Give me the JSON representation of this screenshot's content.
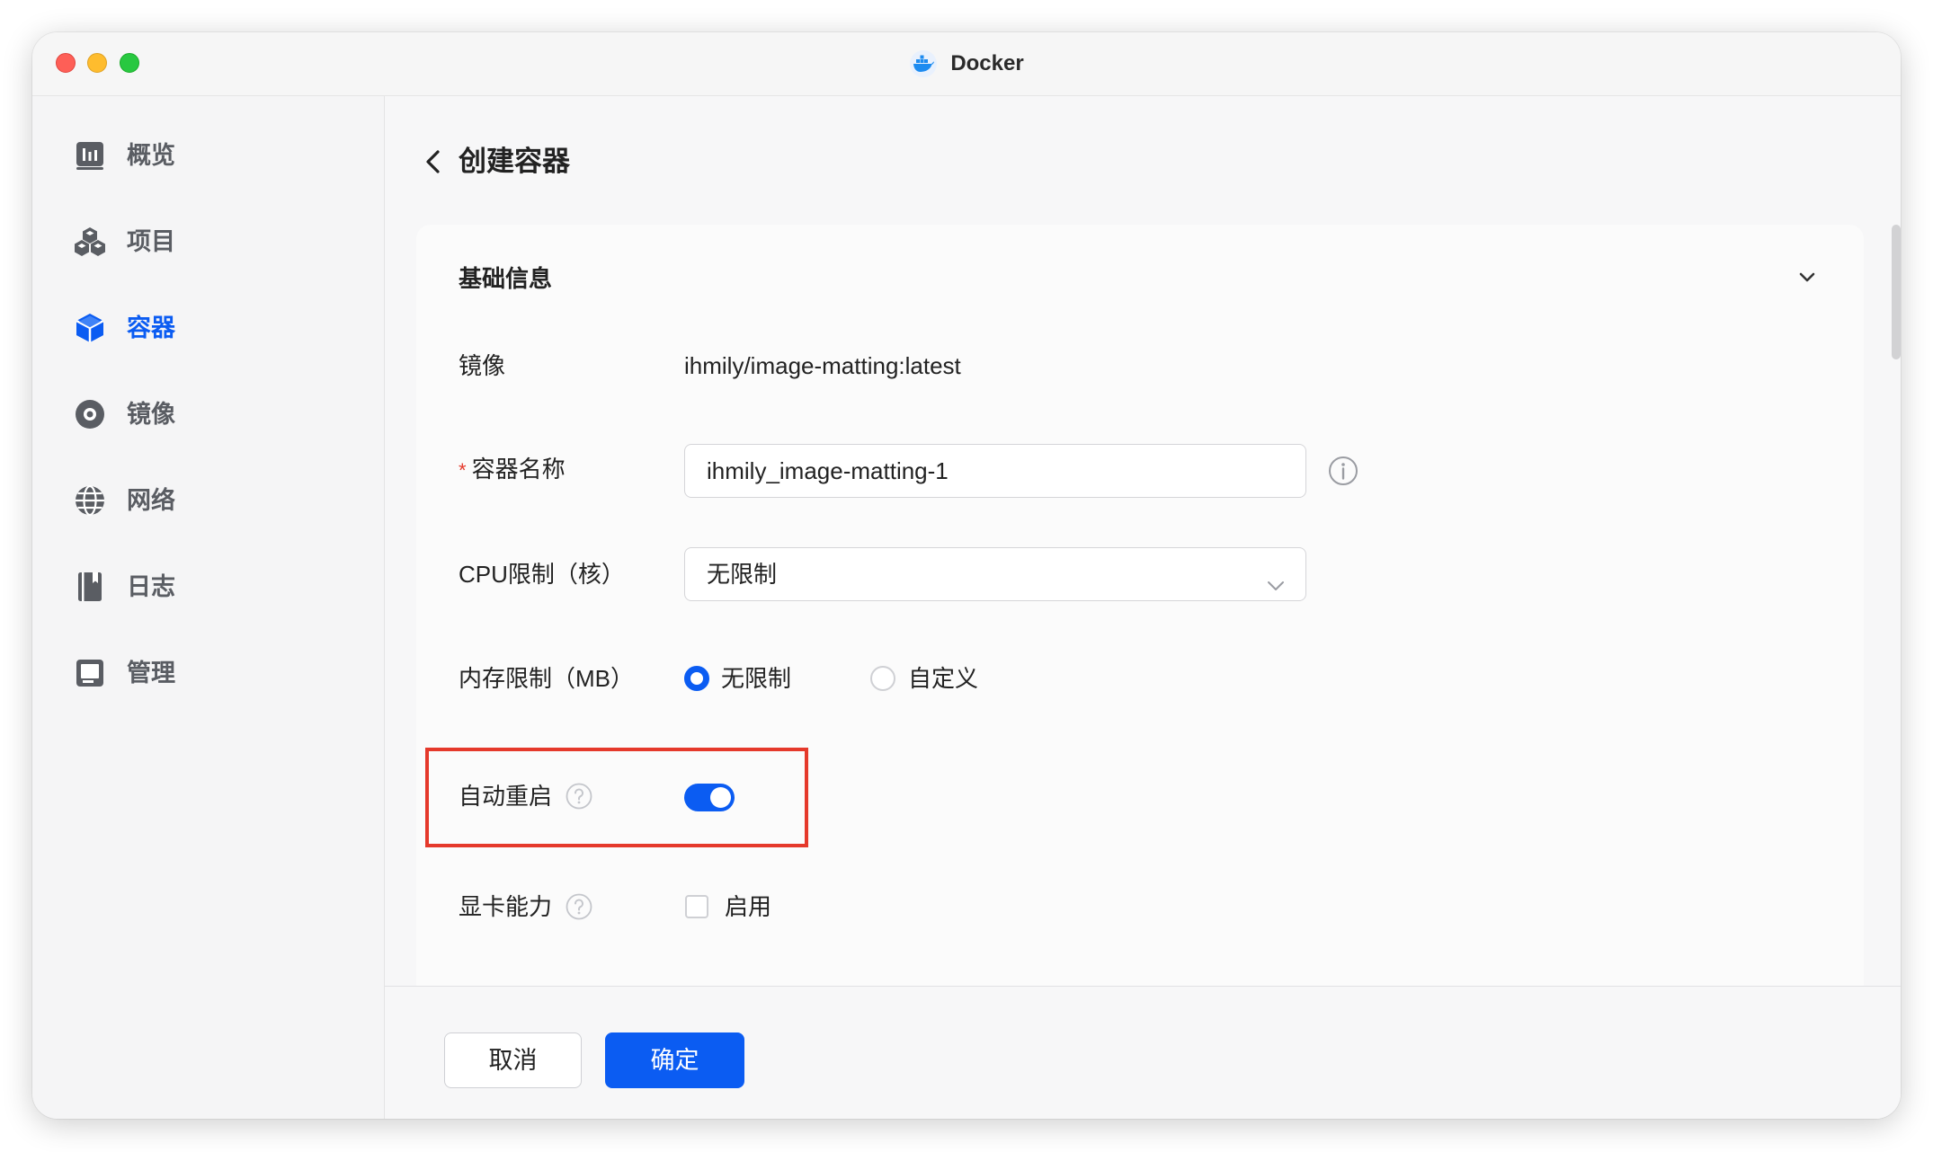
{
  "window": {
    "title": "Docker"
  },
  "sidebar": {
    "items": [
      {
        "label": "概览",
        "icon": "overview-icon",
        "active": false
      },
      {
        "label": "项目",
        "icon": "project-icon",
        "active": false
      },
      {
        "label": "容器",
        "icon": "container-icon",
        "active": true
      },
      {
        "label": "镜像",
        "icon": "image-icon",
        "active": false
      },
      {
        "label": "网络",
        "icon": "network-icon",
        "active": false
      },
      {
        "label": "日志",
        "icon": "log-icon",
        "active": false
      },
      {
        "label": "管理",
        "icon": "manage-icon",
        "active": false
      }
    ]
  },
  "header": {
    "title": "创建容器"
  },
  "section": {
    "title": "基础信息",
    "expanded": true
  },
  "form": {
    "image": {
      "label": "镜像",
      "value": "ihmily/image-matting:latest"
    },
    "name": {
      "required_mark": "*",
      "label": "容器名称",
      "value": "ihmily_image-matting-1"
    },
    "cpu": {
      "label": "CPU限制（核）",
      "value": "无限制"
    },
    "memory": {
      "label": "内存限制（MB）",
      "options": [
        {
          "label": "无限制",
          "selected": true
        },
        {
          "label": "自定义",
          "selected": false
        }
      ]
    },
    "auto_restart": {
      "label": "自动重启",
      "enabled": true
    },
    "gpu": {
      "label": "显卡能力",
      "checkbox_label": "启用",
      "checked": false
    }
  },
  "footer": {
    "cancel_label": "取消",
    "confirm_label": "确定"
  },
  "colors": {
    "accent": "#0b5cf2",
    "highlight_box": "#e5392b"
  }
}
